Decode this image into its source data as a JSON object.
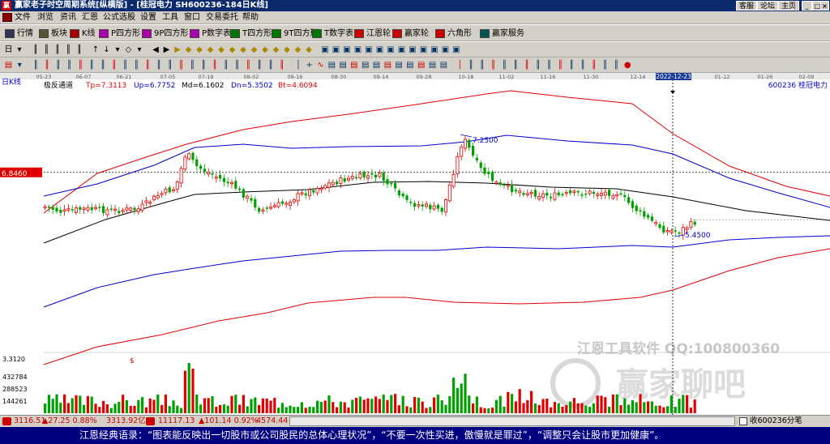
{
  "title": "赢家老子时空周期系统[纵横版] - [桂冠电力  SH600236-184日K线]",
  "title_buttons": [
    "客服",
    "论坛",
    "主页"
  ],
  "menu": [
    "文件",
    "浏览",
    "资讯",
    "汇恩",
    "公式选股",
    "设置",
    "工具",
    "窗口",
    "交易委托",
    "帮助"
  ],
  "toolbar_main": [
    {
      "label": "行情",
      "icon": "grid-icon",
      "color": "#335"
    },
    {
      "label": "板块",
      "icon": "blocks-icon",
      "color": "#553"
    },
    {
      "label": "K线",
      "icon": "kline-icon",
      "color": "#a00"
    },
    {
      "label": "P四方形",
      "icon": "p-square-icon",
      "color": "#a0a"
    },
    {
      "label": "9P四方形",
      "icon": "9p-square-icon",
      "color": "#a0a"
    },
    {
      "label": "P数字表",
      "icon": "p-table-icon",
      "color": "#a0a"
    },
    {
      "label": "T四方形",
      "icon": "t-square-icon",
      "color": "#070"
    },
    {
      "label": "9T四方形",
      "icon": "9t-square-icon",
      "color": "#070"
    },
    {
      "label": "T数字表",
      "icon": "t-table-icon",
      "color": "#070"
    },
    {
      "label": "江恩轮",
      "icon": "gann-wheel-icon",
      "color": "#c00"
    },
    {
      "label": "赢家轮",
      "icon": "winner-wheel-icon",
      "color": "#c00"
    },
    {
      "label": "六角形",
      "icon": "hexagon-icon",
      "color": "#c00"
    },
    {
      "label": "赢家服务",
      "icon": "service-icon",
      "color": "#055"
    }
  ],
  "chart": {
    "period": "日K线",
    "indicator": "极反通道",
    "values": [
      {
        "label": "Tp=7.3113",
        "color": "#e00000"
      },
      {
        "label": "Up=6.7752",
        "color": "#0000cc"
      },
      {
        "label": "Md=6.1602",
        "color": "#000000"
      },
      {
        "label": "Dn=5.3502",
        "color": "#0000cc"
      },
      {
        "label": "Bt=4.6094",
        "color": "#e00000"
      }
    ],
    "stock": "600236 桂冠电力",
    "price_tag": "6.8460",
    "high_label": "7.2500",
    "low_label": "5.4500",
    "date_highlight": "2022-12-23",
    "dates": [
      "05-23",
      "06-07",
      "06-21",
      "07-05",
      "07-19",
      "08-02",
      "08-16",
      "08-30",
      "09-14",
      "09-28",
      "10-18",
      "11-02",
      "11-16",
      "11-30",
      "12-14",
      "01-12",
      "01-26",
      "02-09"
    ],
    "volume_labels": [
      "3.3120",
      "432784",
      "288523",
      "144261"
    ],
    "watermark_1": "江恩工具软件   QQ:100800360",
    "watermark_2": "赢家聊吧"
  },
  "chart_data": {
    "type": "candlestick",
    "series": [
      {
        "name": "Tp",
        "color": "#e00000"
      },
      {
        "name": "Up",
        "color": "#0000cc"
      },
      {
        "name": "Md",
        "color": "#000000"
      },
      {
        "name": "Dn",
        "color": "#0000cc"
      },
      {
        "name": "Bt",
        "color": "#e00000"
      }
    ],
    "current": {
      "Tp": 7.3113,
      "Up": 6.7752,
      "Md": 6.1602,
      "Dn": 5.3502,
      "Bt": 4.6094
    },
    "high": 7.25,
    "low": 5.45
  },
  "status": {
    "index1": "3116.51",
    "index1_chg": "▲27.25 0.88%",
    "index1_vol": "3313.92亿",
    "index2": "11117.13",
    "index2_chg": "▲101.14 0.92%",
    "index2_vol": "4574.44",
    "right": "收600236分笔"
  },
  "quote": "江恩经典语录：“图表能反映出一切股市或公司股民的总体心理状况”，“不要一次性买进，傲慢就是罪过”，“调整只会让股市更加健康”。"
}
